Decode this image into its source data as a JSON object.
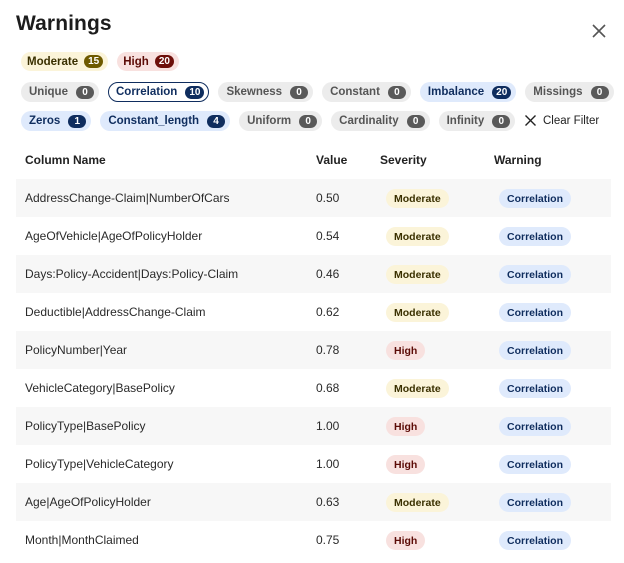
{
  "title": "Warnings",
  "severity_filters": [
    {
      "label": "Moderate",
      "count": "15"
    },
    {
      "label": "High",
      "count": "20"
    }
  ],
  "type_filters_row1": [
    {
      "label": "Unique",
      "count": "0",
      "style": "gray"
    },
    {
      "label": "Correlation",
      "count": "10",
      "style": "selected"
    },
    {
      "label": "Skewness",
      "count": "0",
      "style": "gray"
    },
    {
      "label": "Constant",
      "count": "0",
      "style": "gray"
    },
    {
      "label": "Imbalance",
      "count": "20",
      "style": "blue"
    },
    {
      "label": "Missings",
      "count": "0",
      "style": "gray"
    }
  ],
  "type_filters_row2": [
    {
      "label": "Zeros",
      "count": "1",
      "style": "blue"
    },
    {
      "label": "Constant_length",
      "count": "4",
      "style": "blue"
    },
    {
      "label": "Uniform",
      "count": "0",
      "style": "gray"
    },
    {
      "label": "Cardinality",
      "count": "0",
      "style": "gray"
    },
    {
      "label": "Infinity",
      "count": "0",
      "style": "gray"
    }
  ],
  "clear_filter_label": "Clear Filter",
  "table": {
    "headers": [
      "Column Name",
      "Value",
      "Severity",
      "Warning"
    ],
    "rows": [
      {
        "column": "AddressChange-Claim|NumberOfCars",
        "value": "0.50",
        "severity": "Moderate",
        "warning": "Correlation"
      },
      {
        "column": "AgeOfVehicle|AgeOfPolicyHolder",
        "value": "0.54",
        "severity": "Moderate",
        "warning": "Correlation"
      },
      {
        "column": "Days:Policy-Accident|Days:Policy-Claim",
        "value": "0.46",
        "severity": "Moderate",
        "warning": "Correlation"
      },
      {
        "column": "Deductible|AddressChange-Claim",
        "value": "0.62",
        "severity": "Moderate",
        "warning": "Correlation"
      },
      {
        "column": "PolicyNumber|Year",
        "value": "0.78",
        "severity": "High",
        "warning": "Correlation"
      },
      {
        "column": "VehicleCategory|BasePolicy",
        "value": "0.68",
        "severity": "Moderate",
        "warning": "Correlation"
      },
      {
        "column": "PolicyType|BasePolicy",
        "value": "1.00",
        "severity": "High",
        "warning": "Correlation"
      },
      {
        "column": "PolicyType|VehicleCategory",
        "value": "1.00",
        "severity": "High",
        "warning": "Correlation"
      },
      {
        "column": "Age|AgeOfPolicyHolder",
        "value": "0.63",
        "severity": "Moderate",
        "warning": "Correlation"
      },
      {
        "column": "Month|MonthClaimed",
        "value": "0.75",
        "severity": "High",
        "warning": "Correlation"
      }
    ]
  }
}
